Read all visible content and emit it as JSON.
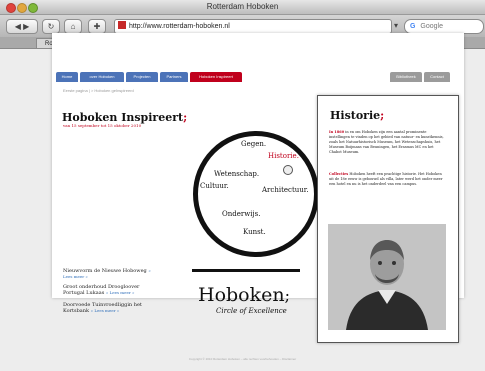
{
  "browser": {
    "window_title": "Rotterdam Hoboken",
    "url": "http://www.rotterdam-hoboken.nl",
    "search_placeholder": "Google",
    "tab_label": "Rotterdam Hoboken",
    "new_tab": "+",
    "back_label": "◀ ▶",
    "icons": [
      "back-icon",
      "forward-icon",
      "reload-icon",
      "home-icon",
      "bookmarks-icon"
    ]
  },
  "site": {
    "nav": [
      {
        "label": "Home",
        "color": "#4c73b8"
      },
      {
        "label": "over Hoboken",
        "color": "#4c73b8"
      },
      {
        "label": "Projecten",
        "color": "#4c73b8"
      },
      {
        "label": "Partners",
        "color": "#4c73b8"
      },
      {
        "label": "Hoboken Inspireert",
        "color": "#c0001c"
      }
    ],
    "right_nav": [
      "Bibliotheek",
      "Contact"
    ],
    "breadcrumb": "Eerste pagina | > Hoboken geïnspireerd",
    "heading_main": "Hoboken Inspireert",
    "heading_semi": ";",
    "dates": "van 15 september tot 15 oktober 2010",
    "links": [
      {
        "text": "Nieuwvorm de Nieuwe Hoboweg",
        "more": "» Lees meer »"
      },
      {
        "text": "Groot onderhoud Droogloover Portugal Lukaas",
        "more": "» Lees meer »"
      },
      {
        "text": "Doorvoede Tuinvroedliggin het Kortsbank",
        "more": "» Lees meer »"
      }
    ],
    "circle_words": {
      "gegen": "Gegen.",
      "historie": "Historie.",
      "wetenschap": "Wetenschap.",
      "cultuur": "Cultuur.",
      "architectuur": "Architectuur.",
      "onderwijs": "Onderwijs.",
      "kunst": "Kunst."
    },
    "logo_main": "Hoboken",
    "logo_semi": ";",
    "logo_sub": "Circle of Excellence",
    "side": {
      "title": "Historie",
      "title_semi": ";",
      "para1_lead": "In 1860",
      "para1": " in en om Hoboken zijn een aantal prominente instellingen te vinden op het gebied van natuur- en kunstkennis, zoals het Natuurhistorisch Museum, het Wetenschapshuis, het Museum Boijmans van Beuningen, het Erasmus MC en het Chabot Museum.",
      "para2_lead": "Collecties",
      "para2": " Hoboken heeft een prachtige historie. Het Hoboken uit de 18e eeuw is gebouwd als villa, later werd het onder meer een hotel en nu is het onderdeel van een campus.",
      "footer_text": "Copyright © 2010 Rotterdam Hoboken – alle rechten voorbehouden – Disclaimer"
    }
  }
}
